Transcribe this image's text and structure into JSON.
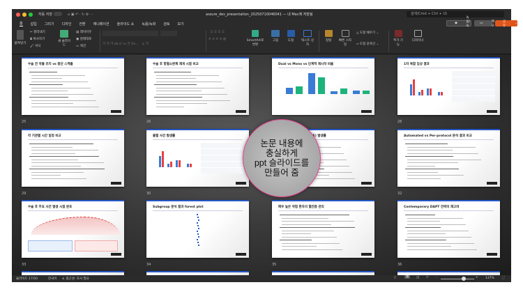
{
  "window": {
    "autosave_label": "자동 저장",
    "title": "assure_des_presentation_20250710046041 — 내 Mac에 저장됨",
    "search_placeholder": "검색(Cmd + Ctrl + U)"
  },
  "tabs": [
    "홈",
    "삽입",
    "그리기",
    "디자인",
    "전환",
    "애니메이션",
    "슬라이드 쇼",
    "녹음/녹화",
    "검토",
    "보기"
  ],
  "ribbon": {
    "paste": "붙여넣기",
    "cut": "잘라내기",
    "copy": "복사하기",
    "format": "서식",
    "new_slide": "새 슬라이드",
    "layout": "레이아웃",
    "reset": "원래대로",
    "section": "섹션",
    "smartart": "SmartArt로 변환",
    "picture": "그림",
    "shapes": "도형",
    "textbox": "텍스트 상자",
    "arrange": "정렬",
    "quick_styles": "빠른 스타일",
    "shape_fill": "도형 채우기",
    "shape_outline": "도형 윤곽선",
    "addins": "추가 기능",
    "designer": "디자이너",
    "record": "녹음/녹화",
    "comments": "메모",
    "share": "공유"
  },
  "colors": {
    "accent": "#2457c5",
    "share": "#e0561a",
    "lens_border": "#e0408c"
  },
  "slides": [
    {
      "num": "25",
      "title": "수술 전 약물 유지 vs 중단 스케줄"
    },
    {
      "num": "26",
      "title": "수술 후 항혈소판제 재개 시점 비교"
    },
    {
      "num": "27",
      "title": "Dual vs Mono vs 단계적 재시작 비율"
    },
    {
      "num": "28",
      "title": "1차 복합 임상 결과"
    },
    {
      "num": "29",
      "title": "각 기관별 시간 일정 비교"
    },
    {
      "num": "30",
      "title": "출혈 사건 발생률"
    },
    {
      "num": "31",
      "title": "Clinical Events(NACE) 발생률"
    },
    {
      "num": "32",
      "title": "Automated vs Per-protocol 분석 결과 비교"
    },
    {
      "num": "33",
      "title": "수술 후 주요 사건 발생 시점 분포"
    },
    {
      "num": "34",
      "title": "Subgroup 분석 결과 forest plot"
    },
    {
      "num": "35",
      "title": "매우 높은 위험 환자의 혈전증 관리"
    },
    {
      "num": "36",
      "title": "Contemporary DAPT 전략의 재고려"
    }
  ],
  "overlay": {
    "text": "논문 내용에\n충실하게\nppt 슬라이드를\n만들어 줌"
  },
  "status": {
    "slide": "슬라이드 17/50",
    "language": "한국어",
    "accessibility": "접근성: 조사 필요",
    "zoom": "137%"
  },
  "zoom_level_percent": 137
}
